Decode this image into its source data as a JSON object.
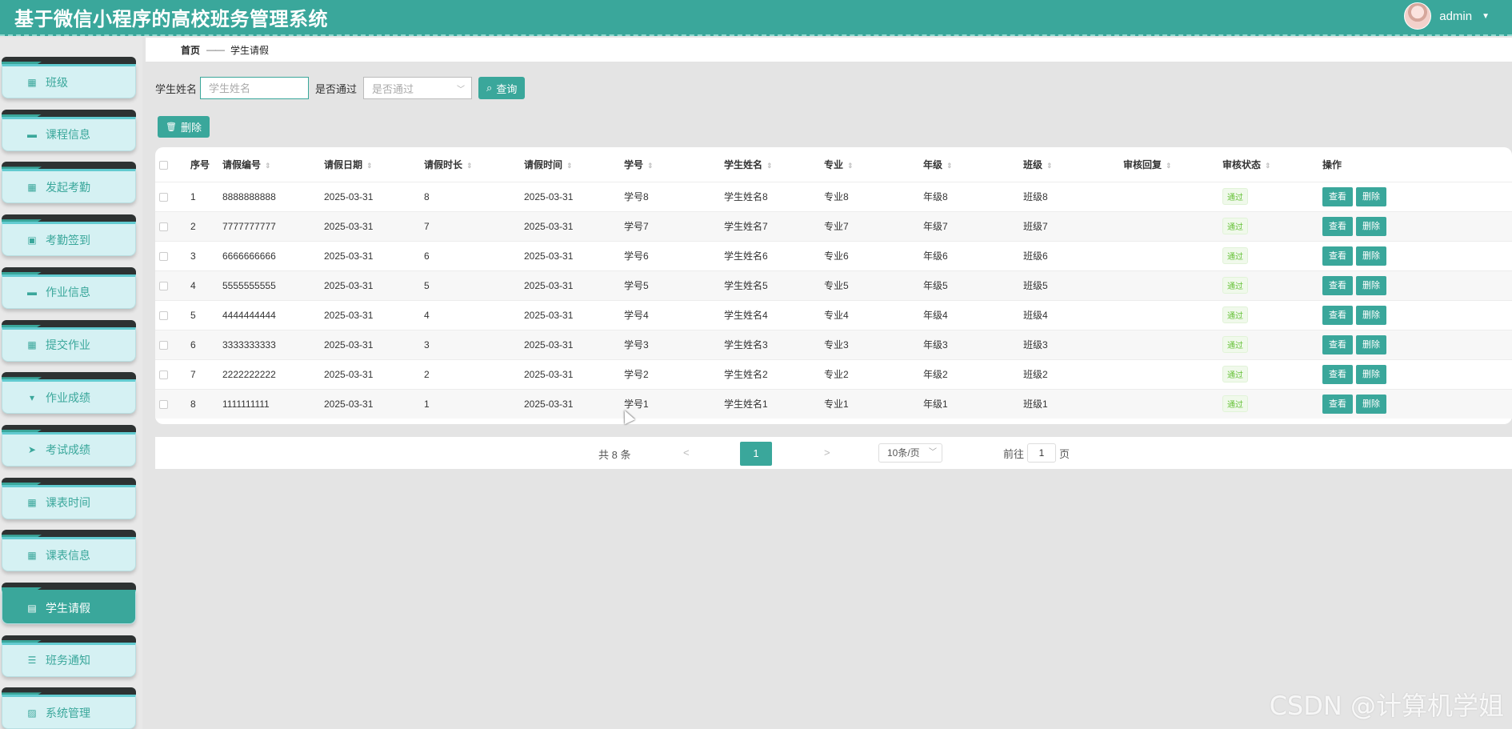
{
  "header": {
    "title": "基于微信小程序的高校班务管理系统",
    "username": "admin"
  },
  "sidebar": {
    "items": [
      {
        "label": "班级",
        "icon": "grid-icon"
      },
      {
        "label": "课程信息",
        "icon": "monitor-icon"
      },
      {
        "label": "发起考勤",
        "icon": "grid-icon"
      },
      {
        "label": "考勤签到",
        "icon": "clipboard-check-icon"
      },
      {
        "label": "作业信息",
        "icon": "monitor-icon"
      },
      {
        "label": "提交作业",
        "icon": "grid-icon"
      },
      {
        "label": "作业成绩",
        "icon": "pin-icon"
      },
      {
        "label": "考试成绩",
        "icon": "send-icon"
      },
      {
        "label": "课表时间",
        "icon": "grid-icon"
      },
      {
        "label": "课表信息",
        "icon": "grid-icon"
      },
      {
        "label": "学生请假",
        "icon": "clipboard-icon",
        "active": true
      },
      {
        "label": "班务通知",
        "icon": "list-icon"
      },
      {
        "label": "系统管理",
        "icon": "chart-icon"
      }
    ]
  },
  "breadcrumb": {
    "home": "首页",
    "separator": "——",
    "current": "学生请假"
  },
  "search": {
    "name_label": "学生姓名",
    "name_placeholder": "学生姓名",
    "pass_label": "是否通过",
    "pass_placeholder": "是否通过",
    "query_button": "查询"
  },
  "toolbar": {
    "delete_button": "删除"
  },
  "table": {
    "columns": [
      "序号",
      "请假编号",
      "请假日期",
      "请假时长",
      "请假时间",
      "学号",
      "学生姓名",
      "专业",
      "年级",
      "班级",
      "审核回复",
      "审核状态",
      "操作"
    ],
    "rows": [
      {
        "index": "1",
        "code": "8888888888",
        "date": "2025-03-31",
        "duration": "8",
        "time": "2025-03-31",
        "student_no": "学号8",
        "student_name": "学生姓名8",
        "major": "专业8",
        "grade": "年级8",
        "class": "班级8",
        "reply": "",
        "status": "通过"
      },
      {
        "index": "2",
        "code": "7777777777",
        "date": "2025-03-31",
        "duration": "7",
        "time": "2025-03-31",
        "student_no": "学号7",
        "student_name": "学生姓名7",
        "major": "专业7",
        "grade": "年级7",
        "class": "班级7",
        "reply": "",
        "status": "通过"
      },
      {
        "index": "3",
        "code": "6666666666",
        "date": "2025-03-31",
        "duration": "6",
        "time": "2025-03-31",
        "student_no": "学号6",
        "student_name": "学生姓名6",
        "major": "专业6",
        "grade": "年级6",
        "class": "班级6",
        "reply": "",
        "status": "通过"
      },
      {
        "index": "4",
        "code": "5555555555",
        "date": "2025-03-31",
        "duration": "5",
        "time": "2025-03-31",
        "student_no": "学号5",
        "student_name": "学生姓名5",
        "major": "专业5",
        "grade": "年级5",
        "class": "班级5",
        "reply": "",
        "status": "通过"
      },
      {
        "index": "5",
        "code": "4444444444",
        "date": "2025-03-31",
        "duration": "4",
        "time": "2025-03-31",
        "student_no": "学号4",
        "student_name": "学生姓名4",
        "major": "专业4",
        "grade": "年级4",
        "class": "班级4",
        "reply": "",
        "status": "通过"
      },
      {
        "index": "6",
        "code": "3333333333",
        "date": "2025-03-31",
        "duration": "3",
        "time": "2025-03-31",
        "student_no": "学号3",
        "student_name": "学生姓名3",
        "major": "专业3",
        "grade": "年级3",
        "class": "班级3",
        "reply": "",
        "status": "通过"
      },
      {
        "index": "7",
        "code": "2222222222",
        "date": "2025-03-31",
        "duration": "2",
        "time": "2025-03-31",
        "student_no": "学号2",
        "student_name": "学生姓名2",
        "major": "专业2",
        "grade": "年级2",
        "class": "班级2",
        "reply": "",
        "status": "通过"
      },
      {
        "index": "8",
        "code": "1111111111",
        "date": "2025-03-31",
        "duration": "1",
        "time": "2025-03-31",
        "student_no": "学号1",
        "student_name": "学生姓名1",
        "major": "专业1",
        "grade": "年级1",
        "class": "班级1",
        "reply": "",
        "status": "通过"
      }
    ],
    "view_button": "查看",
    "delete_button": "删除"
  },
  "pagination": {
    "total_text": "共 8 条",
    "prev": "<",
    "next": ">",
    "current_page": "1",
    "page_size": "10条/页",
    "goto_label": "前往",
    "goto_value": "1",
    "goto_suffix": "页"
  },
  "watermark": "CSDN @计算机学姐",
  "colors": {
    "accent": "#3aa79b",
    "sidebar_item_bg": "#d5f1f3",
    "status_green": "#67c23a"
  }
}
